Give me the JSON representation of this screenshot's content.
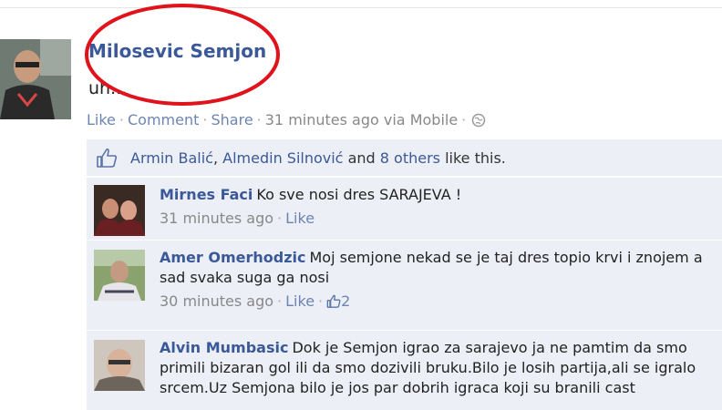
{
  "post": {
    "author": "Milosevic Semjon",
    "text": "uh...",
    "actions": {
      "like": "Like",
      "comment": "Comment",
      "share": "Share",
      "time": "31 minutes ago via Mobile"
    }
  },
  "likes": {
    "person1": "Armin Balić",
    "sep": ", ",
    "person2": "Almedin Silnović",
    "and": " and ",
    "others": "8 others",
    "suffix": " like this."
  },
  "comments": [
    {
      "name": "Mirnes Faci",
      "text": "Ko sve nosi dres SARAJEVA !",
      "time": "31 minutes ago",
      "like": "Like"
    },
    {
      "name": "Amer Omerhodzic",
      "text": "Moj semjone nekad se je taj dres topio krvi i znojem a sad svaka suga ga nosi",
      "time": "30 minutes ago",
      "like": "Like",
      "like_count": "2"
    },
    {
      "name": "Alvin Mumbasic",
      "text": "Dok je Semjon igrao za sarajevo ja ne pamtim da smo primili bizaran gol ili da smo dozivili bruku.Bilo je losih partija,ali se igralo srcem.Uz Semjona bilo je jos par dobrih igraca koji su branili cast"
    }
  ],
  "colors": {
    "link": "#3b5998",
    "muted_link": "#6d84b4",
    "panel": "#eceff5",
    "annotation": "#e0121b"
  },
  "icons": [
    "globe-icon",
    "thumbs-up-icon",
    "avatar"
  ]
}
